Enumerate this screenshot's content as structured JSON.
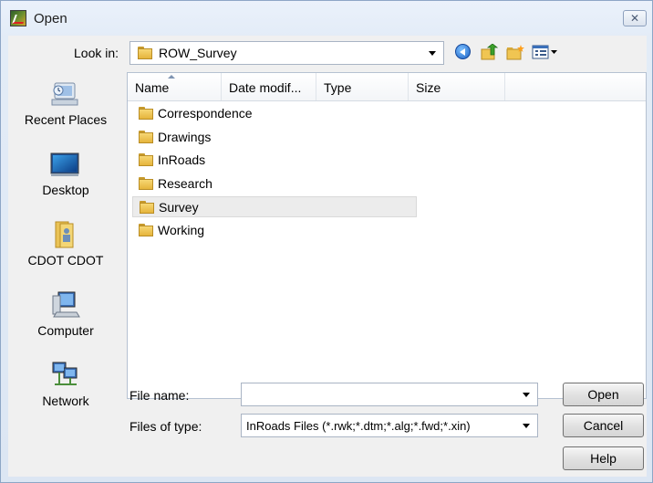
{
  "window": {
    "title": "Open",
    "close_symbol": "✕"
  },
  "look_in": {
    "label": "Look in:",
    "value": "ROW_Survey"
  },
  "toolbar": {
    "icons": [
      "back-icon",
      "up-folder-icon",
      "new-folder-icon",
      "views-menu-icon"
    ]
  },
  "places": [
    {
      "label": "Recent Places",
      "icon": "recent-places-icon"
    },
    {
      "label": "Desktop",
      "icon": "desktop-icon"
    },
    {
      "label": "CDOT CDOT",
      "icon": "user-folder-icon"
    },
    {
      "label": "Computer",
      "icon": "computer-icon"
    },
    {
      "label": "Network",
      "icon": "network-icon"
    }
  ],
  "columns": [
    "Name",
    "Date modif...",
    "Type",
    "Size"
  ],
  "files": [
    {
      "name": "Correspondence",
      "selected": false
    },
    {
      "name": "Drawings",
      "selected": false
    },
    {
      "name": "InRoads",
      "selected": false
    },
    {
      "name": "Research",
      "selected": false
    },
    {
      "name": "Survey",
      "selected": true
    },
    {
      "name": "Working",
      "selected": false
    }
  ],
  "file_name": {
    "label": "File name:",
    "value": ""
  },
  "file_type": {
    "label": "Files of type:",
    "value": "InRoads Files (*.rwk;*.dtm;*.alg;*.fwd;*.xin)"
  },
  "buttons": {
    "open": "Open",
    "cancel": "Cancel",
    "help": "Help"
  },
  "colors": {
    "selection": "#ececec",
    "title_bg": "#e3ecf7"
  }
}
